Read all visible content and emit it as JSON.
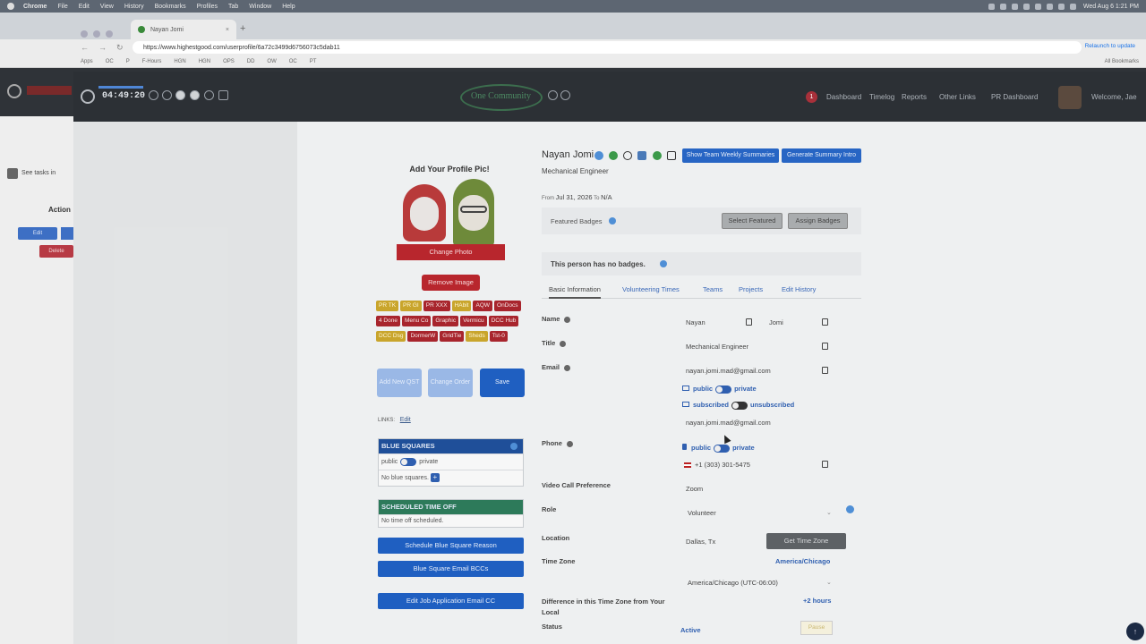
{
  "mac_menu": {
    "items": [
      "Chrome",
      "File",
      "Edit",
      "View",
      "History",
      "Bookmarks",
      "Profiles",
      "Tab",
      "Window",
      "Help"
    ],
    "clock": "Wed Aug 6  1:21 PM"
  },
  "browser": {
    "tab_title": "Nayan Jomi",
    "url": "https://www.highestgood.com/userprofile/6a72c3499d6756073c5dab11",
    "relaunch": "Relaunch to update",
    "bookmarks": [
      "Apps",
      "OC",
      "P",
      "F-Hours",
      "HGN",
      "HGN",
      "OPS",
      "DD",
      "OW",
      "OC",
      "PT",
      "All Bookmarks"
    ]
  },
  "bg_app": {
    "task_text": "See tasks in",
    "action_header": "Action",
    "edit_label": "Edit",
    "delete_label": "Delete"
  },
  "nav": {
    "timer": "04:49:20",
    "logo_text": "One Community",
    "notifications": "1",
    "links": [
      "Dashboard",
      "Timelog",
      "Reports",
      "Other Links",
      "PR Dashboard"
    ],
    "welcome": "Welcome, Jae"
  },
  "profile": {
    "add_pic_title": "Add Your Profile Pic!",
    "change_photo": "Change Photo",
    "remove_image": "Remove Image",
    "chips": [
      {
        "label": "PR TK",
        "color": "yellow"
      },
      {
        "label": "PR GI",
        "color": "yellow"
      },
      {
        "label": "PR XXX",
        "color": "red"
      },
      {
        "label": "HAbit",
        "color": "yellow"
      },
      {
        "label": "AQW",
        "color": "red"
      },
      {
        "label": "OnDocs",
        "color": "red"
      },
      {
        "label": "4 Done",
        "color": "red"
      },
      {
        "label": "Menu Co",
        "color": "red"
      },
      {
        "label": "Graphic",
        "color": "red"
      },
      {
        "label": "Vermicu",
        "color": "red"
      },
      {
        "label": "DCC Hub",
        "color": "red"
      },
      {
        "label": "DCC Dsg",
        "color": "yellow"
      },
      {
        "label": "DormerW",
        "color": "red"
      },
      {
        "label": "GridTie",
        "color": "red"
      },
      {
        "label": "Sheds",
        "color": "yellow"
      },
      {
        "label": "Tst-0",
        "color": "red"
      }
    ],
    "add_new_qst": "Add New QST",
    "change_order": "Change Order",
    "save": "Save",
    "links_label": "LINKS:",
    "links_edit": "Edit",
    "blue_squares_title": "BLUE SQUARES",
    "public": "public",
    "private": "private",
    "no_blue_squares": "No blue squares.",
    "scheduled_time_off": "SCHEDULED TIME OFF",
    "no_time_off": "No time off scheduled.",
    "schedule_blue_square": "Schedule Blue Square Reason",
    "blue_square_email": "Blue Square Email BCCs",
    "edit_job_email": "Edit Job Application Email CC"
  },
  "details": {
    "name": "Nayan Jomi",
    "title": "Mechanical Engineer",
    "show_summaries": "Show Team Weekly Summaries",
    "generate_summary": "Generate Summary Intro",
    "from_label": "From",
    "from_date": "Jul 31, 2026",
    "to_label": "To",
    "to_value": "N/A",
    "featured_badges": "Featured Badges",
    "select_featured": "Select Featured",
    "assign_badges": "Assign Badges",
    "no_badges": "This person has no badges.",
    "tabs": [
      "Basic Information",
      "Volunteering Times",
      "Teams",
      "Projects",
      "Edit History"
    ],
    "fields": {
      "name_label": "Name",
      "first_name": "Nayan",
      "last_name": "Jomi",
      "title_label": "Title",
      "title_value": "Mechanical Engineer",
      "email_label": "Email",
      "email_value": "nayan.jomi.mad@gmail.com",
      "public": "public",
      "private": "private",
      "subscribed": "subscribed",
      "unsubscribed": "unsubscribed",
      "email_value2": "nayan.jomi.mad@gmail.com",
      "phone_label": "Phone",
      "phone_value": "+1 (303) 301-5475",
      "video_label": "Video Call Preference",
      "video_value": "Zoom",
      "role_label": "Role",
      "role_value": "Volunteer",
      "location_label": "Location",
      "location_value": "Dallas, Tx",
      "get_time_zone": "Get Time Zone",
      "timezone_label": "Time Zone",
      "timezone_link": "America/Chicago",
      "timezone_select": "America/Chicago (UTC-06:00)",
      "difference_label": "Difference in this Time Zone from Your Local",
      "difference_value": "+2 hours",
      "status_label": "Status",
      "status_value": "Active",
      "status_button": "Pause"
    }
  }
}
